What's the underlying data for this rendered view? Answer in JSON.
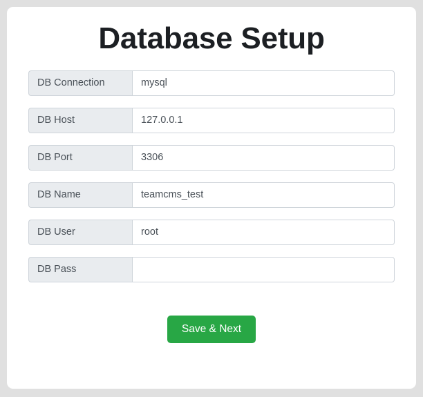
{
  "page": {
    "title": "Database Setup",
    "card_background": "#ffffff",
    "body_background": "#e0e0e0"
  },
  "form": {
    "fields": [
      {
        "label": "DB Connection",
        "value": "mysql",
        "placeholder": "",
        "name": "db-connection"
      },
      {
        "label": "DB Host",
        "value": "127.0.0.1",
        "placeholder": "",
        "name": "db-host"
      },
      {
        "label": "DB Port",
        "value": "3306",
        "placeholder": "",
        "name": "db-port"
      },
      {
        "label": "DB Name",
        "value": "teamcms_test",
        "placeholder": "",
        "name": "db-name"
      },
      {
        "label": "DB User",
        "value": "root",
        "placeholder": "",
        "name": "db-user"
      },
      {
        "label": "DB Pass",
        "value": "",
        "placeholder": "",
        "name": "db-pass"
      }
    ],
    "submit_label": "Save & Next",
    "submit_color": "#28a745",
    "label_background": "#e9ecef",
    "border_color": "#ced4da",
    "text_color": "#495057"
  }
}
